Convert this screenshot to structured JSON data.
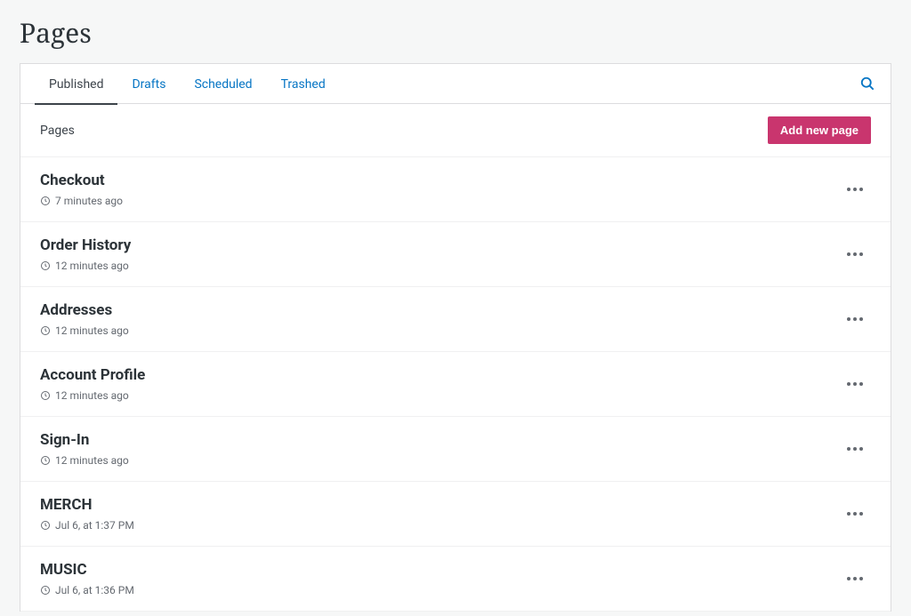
{
  "header": {
    "title": "Pages"
  },
  "tabs": [
    {
      "label": "Published",
      "active": true
    },
    {
      "label": "Drafts",
      "active": false
    },
    {
      "label": "Scheduled",
      "active": false
    },
    {
      "label": "Trashed",
      "active": false
    }
  ],
  "list": {
    "heading": "Pages",
    "add_button": "Add new page",
    "items": [
      {
        "title": "Checkout",
        "timestamp": "7 minutes ago"
      },
      {
        "title": "Order History",
        "timestamp": "12 minutes ago"
      },
      {
        "title": "Addresses",
        "timestamp": "12 minutes ago"
      },
      {
        "title": "Account Profile",
        "timestamp": "12 minutes ago"
      },
      {
        "title": "Sign-In",
        "timestamp": "12 minutes ago"
      },
      {
        "title": "MERCH",
        "timestamp": "Jul 6, at 1:37 PM"
      },
      {
        "title": "MUSIC",
        "timestamp": "Jul 6, at 1:36 PM"
      }
    ]
  }
}
